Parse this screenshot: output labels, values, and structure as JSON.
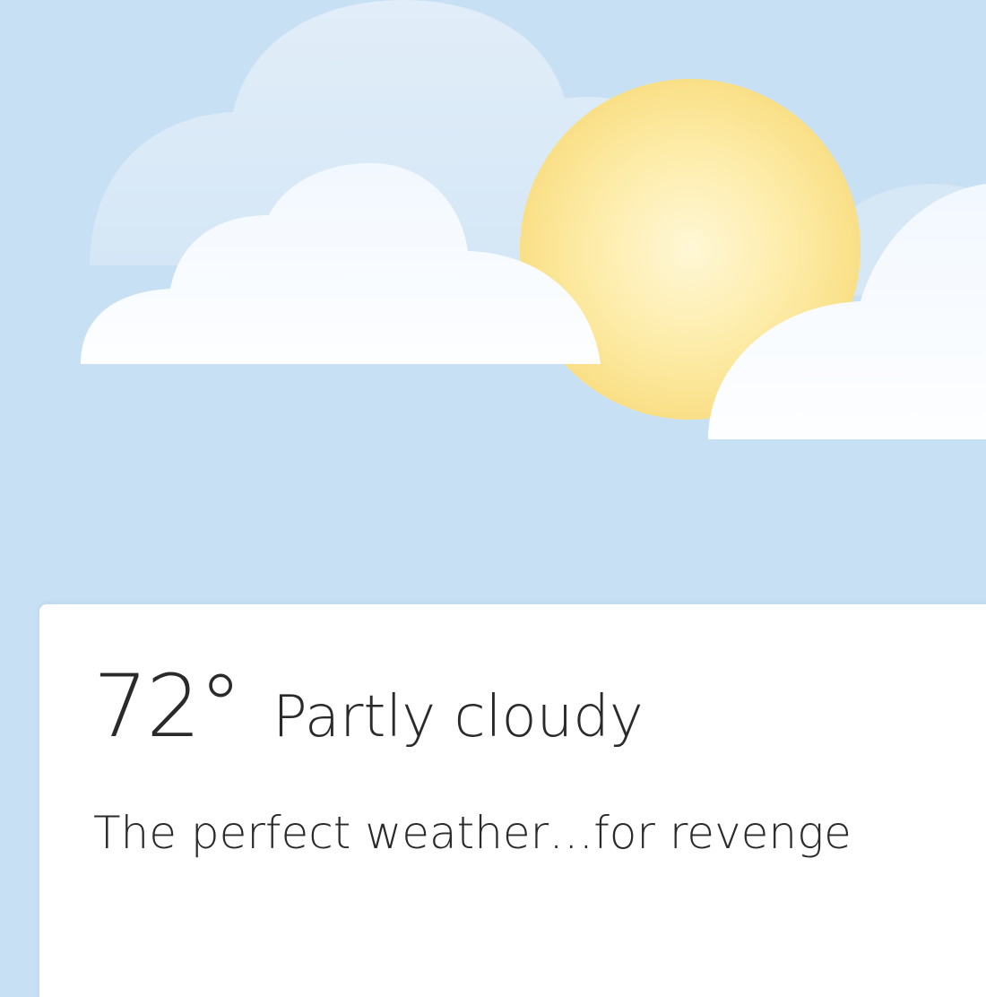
{
  "weather": {
    "temperature": "72°",
    "condition": "Partly cloudy",
    "tagline": "The perfect weather…for revenge"
  },
  "colors": {
    "sky": "#c8e0f4",
    "sun": "#fde79a",
    "cloud": "#fbfdff",
    "card": "#ffffff",
    "text": "#2a2a2a"
  },
  "icons": {
    "sun": "sun-icon",
    "cloud": "cloud-icon"
  }
}
